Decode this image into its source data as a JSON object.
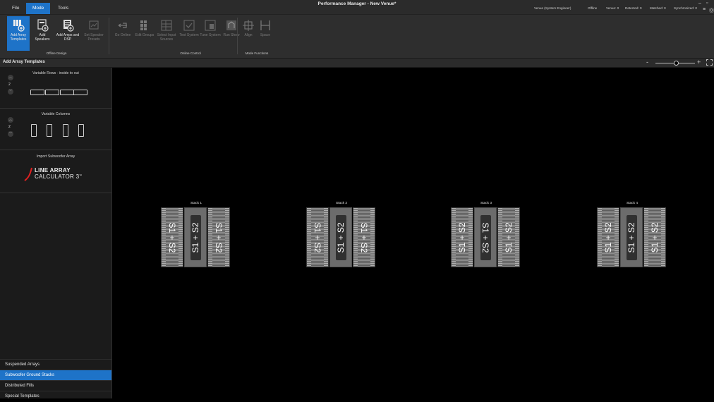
{
  "window": {
    "title": "Performance Manager - New Venue*",
    "menu": [
      "File",
      "Mode",
      "Tools"
    ],
    "active_menu": "Mode"
  },
  "status": {
    "user": "Venue (System Engineer)",
    "mode": "Offline",
    "venue": "Venue: 0",
    "detected": "Detected: 0",
    "matched": "Matched: 0",
    "synchronized": "Synchronized: 0"
  },
  "ribbon": {
    "buttons": [
      {
        "label": "Add Array Templates",
        "icon": "array-templates-icon",
        "state": "selected"
      },
      {
        "label": "Add Speakers",
        "icon": "speaker-icon",
        "state": "enabled"
      },
      {
        "label": "Add Amps and DSP",
        "icon": "amp-icon",
        "state": "enabled"
      },
      {
        "label": "Set Speaker Presets",
        "icon": "preset-icon",
        "state": "disabled"
      },
      {
        "label": "Go Online",
        "icon": "online-icon",
        "state": "disabled"
      },
      {
        "label": "Edit Groups",
        "icon": "groups-icon",
        "state": "disabled"
      },
      {
        "label": "Select Input Sources",
        "icon": "input-sources-icon",
        "state": "disabled"
      },
      {
        "label": "Test System",
        "icon": "test-icon",
        "state": "disabled"
      },
      {
        "label": "Tune System",
        "icon": "tune-icon",
        "state": "disabled"
      },
      {
        "label": "Run Show",
        "icon": "run-show-icon",
        "state": "disabled"
      },
      {
        "label": "Align",
        "icon": "align-icon",
        "state": "disabled"
      },
      {
        "label": "Space",
        "icon": "space-icon",
        "state": "disabled"
      }
    ],
    "groups": [
      "Offline Design",
      "Online Control",
      "Mode Functions"
    ]
  },
  "panel": {
    "header": "Add Array Templates",
    "templates": [
      {
        "title": "Variable Rows - inside to out",
        "count": "2"
      },
      {
        "title": "Variable Columns",
        "count": "2"
      },
      {
        "title": "Import Subwoofer Array",
        "logo_line1": "LINE ARRAY",
        "logo_line2": "CALCULATOR 3",
        "logo_sup": "™"
      }
    ],
    "categories": [
      {
        "label": "Suspended Arrays",
        "active": false
      },
      {
        "label": "Subwoofer Ground Stacks",
        "active": true
      },
      {
        "label": "Distributed Fills",
        "active": false
      },
      {
        "label": "Special Templates",
        "active": false
      }
    ]
  },
  "zoom": {
    "minus": "-",
    "plus": "+"
  },
  "stacks": [
    {
      "name": "Stack 1",
      "cabinets": [
        {
          "label": "S1 + S2",
          "orient": "rear",
          "solid": false
        },
        {
          "label": "S1 + S2",
          "orient": "front",
          "solid": true
        },
        {
          "label": "S1 + S2",
          "orient": "rear",
          "solid": false
        }
      ]
    },
    {
      "name": "Stack 2",
      "cabinets": [
        {
          "label": "S1 + S2",
          "orient": "rear",
          "solid": false
        },
        {
          "label": "S1 + S2",
          "orient": "front",
          "solid": true
        },
        {
          "label": "S1 + S2",
          "orient": "rear",
          "solid": false
        }
      ]
    },
    {
      "name": "Stack 3",
      "cabinets": [
        {
          "label": "S1 + S2",
          "orient": "front",
          "solid": false
        },
        {
          "label": "S1 + S2",
          "orient": "rear",
          "solid": true
        },
        {
          "label": "S1 + S2",
          "orient": "front",
          "solid": false
        }
      ]
    },
    {
      "name": "Stack 4",
      "cabinets": [
        {
          "label": "S1 + S2",
          "orient": "front",
          "solid": false
        },
        {
          "label": "S1 + S2",
          "orient": "front",
          "solid": true
        },
        {
          "label": "S1 + S2",
          "orient": "front",
          "solid": false
        }
      ]
    }
  ]
}
